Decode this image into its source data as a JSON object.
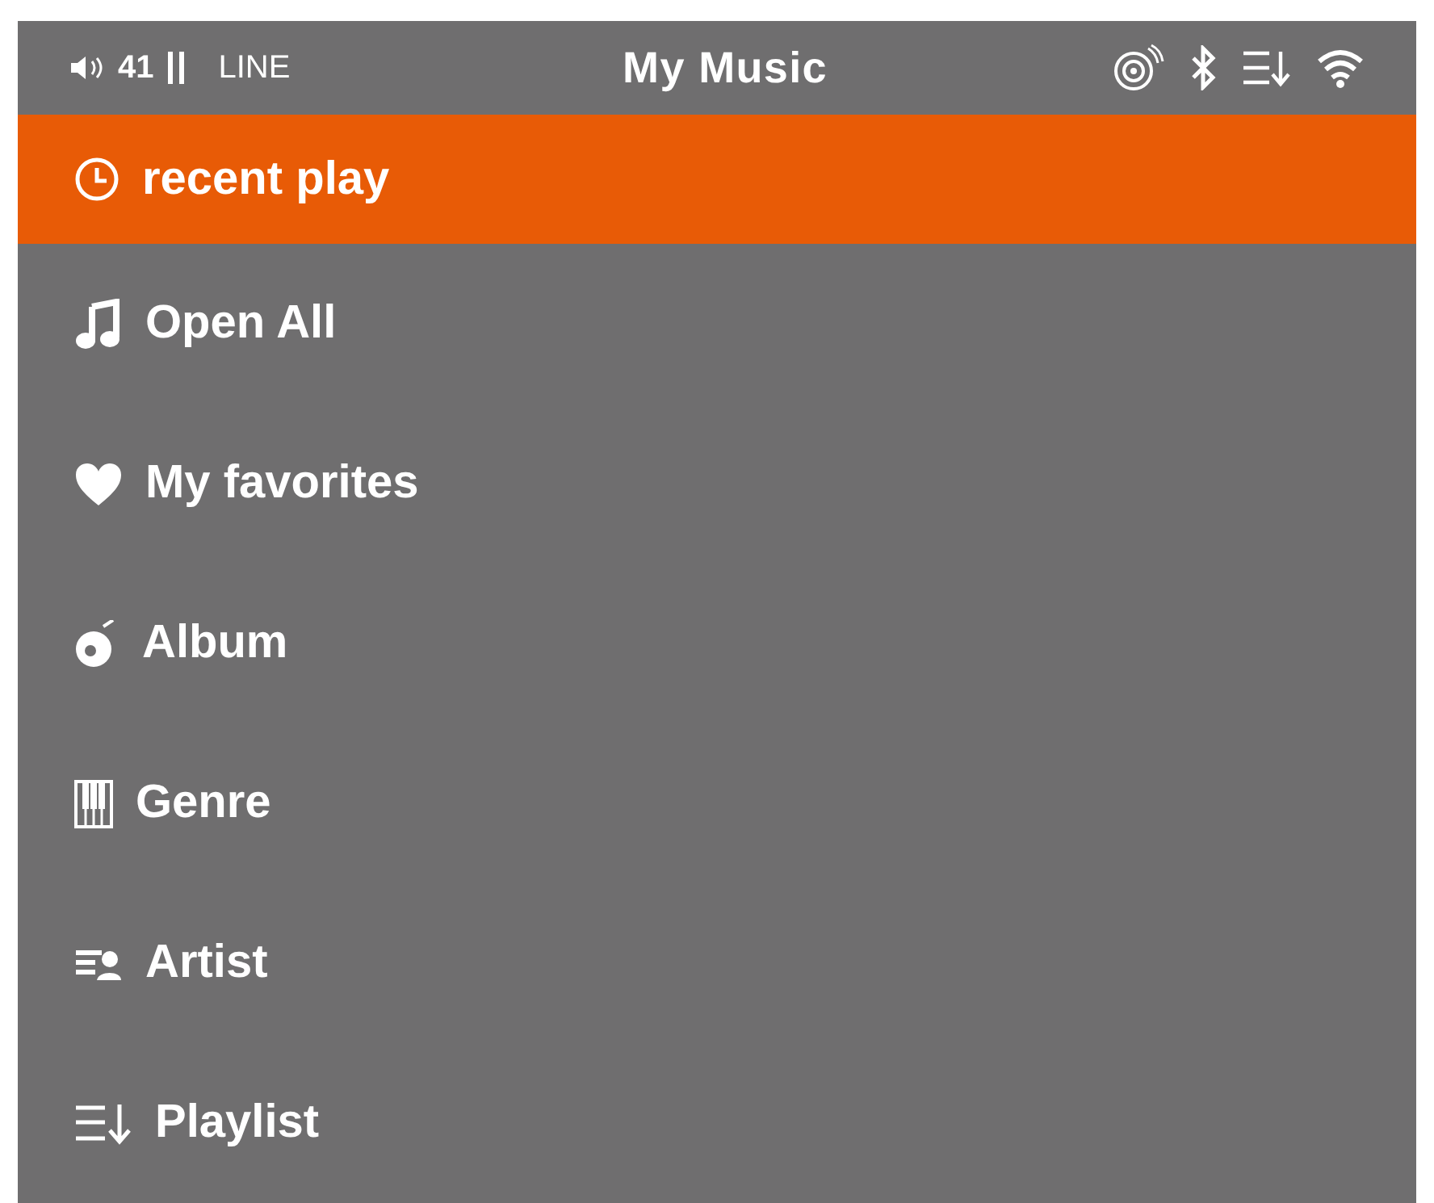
{
  "status_bar": {
    "volume": "41",
    "source": "LINE",
    "title": "My Music"
  },
  "menu": [
    {
      "label": "recent play",
      "kind": "clock",
      "selected": true
    },
    {
      "label": "Open All",
      "kind": "note",
      "selected": false
    },
    {
      "label": "My favorites",
      "kind": "heart",
      "selected": false
    },
    {
      "label": "Album",
      "kind": "disc",
      "selected": false
    },
    {
      "label": "Genre",
      "kind": "piano",
      "selected": false
    },
    {
      "label": "Artist",
      "kind": "artist",
      "selected": false
    },
    {
      "label": "Playlist",
      "kind": "playlist",
      "selected": false
    }
  ]
}
